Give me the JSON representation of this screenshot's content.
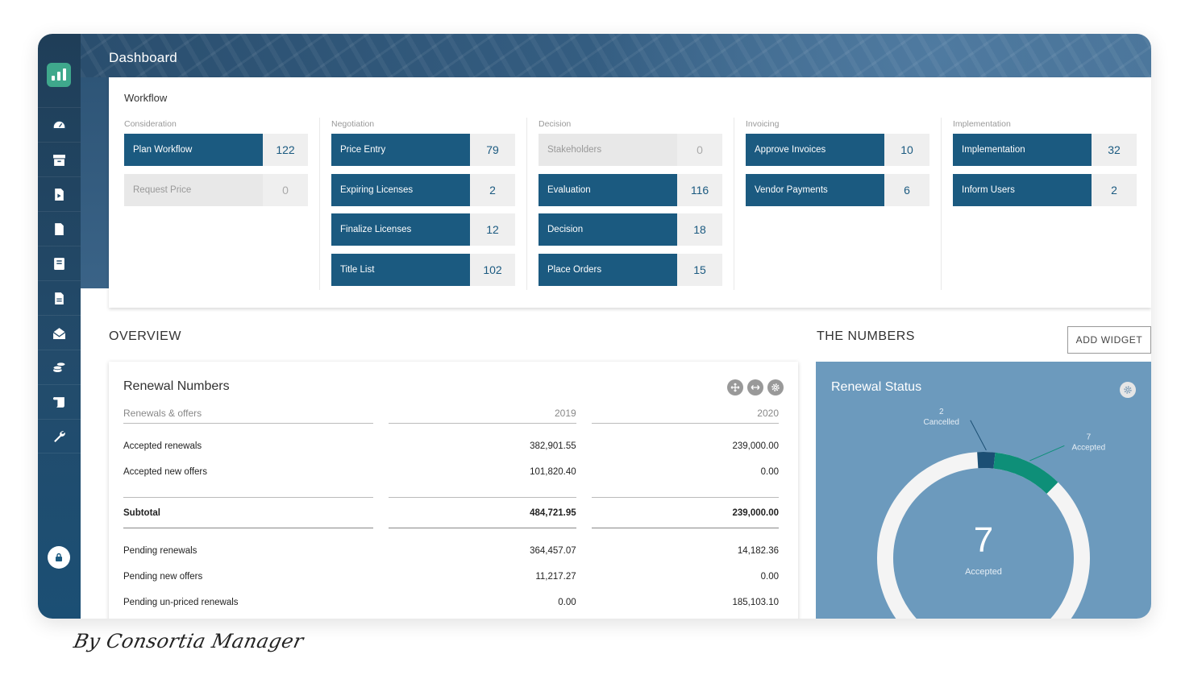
{
  "page": {
    "title": "Dashboard"
  },
  "workflow": {
    "title": "Workflow",
    "columns": [
      {
        "label": "Consideration",
        "items": [
          {
            "label": "Plan Workflow",
            "count": "122",
            "active": true
          },
          {
            "label": "Request Price",
            "count": "0",
            "active": false
          }
        ]
      },
      {
        "label": "Negotiation",
        "items": [
          {
            "label": "Price Entry",
            "count": "79",
            "active": true
          },
          {
            "label": "Expiring Licenses",
            "count": "2",
            "active": true
          },
          {
            "label": "Finalize Licenses",
            "count": "12",
            "active": true
          },
          {
            "label": "Title List",
            "count": "102",
            "active": true
          }
        ]
      },
      {
        "label": "Decision",
        "items": [
          {
            "label": "Stakeholders",
            "count": "0",
            "active": false
          },
          {
            "label": "Evaluation",
            "count": "116",
            "active": true
          },
          {
            "label": "Decision",
            "count": "18",
            "active": true
          },
          {
            "label": "Place Orders",
            "count": "15",
            "active": true
          }
        ]
      },
      {
        "label": "Invoicing",
        "items": [
          {
            "label": "Approve Invoices",
            "count": "10",
            "active": true
          },
          {
            "label": "Vendor Payments",
            "count": "6",
            "active": true
          }
        ]
      },
      {
        "label": "Implementation",
        "items": [
          {
            "label": "Implementation",
            "count": "32",
            "active": true
          },
          {
            "label": "Inform Users",
            "count": "2",
            "active": true
          }
        ]
      }
    ]
  },
  "overview": {
    "heading": "OVERVIEW",
    "card_title": "Renewal Numbers",
    "columns": [
      "Renewals & offers",
      "2019",
      "2020"
    ],
    "rows_top": [
      {
        "label": "Accepted renewals",
        "y2019": "382,901.55",
        "y2020": "239,000.00"
      },
      {
        "label": "Accepted new offers",
        "y2019": "101,820.40",
        "y2020": "0.00"
      }
    ],
    "subtotal": {
      "label": "Subtotal",
      "y2019": "484,721.95",
      "y2020": "239,000.00"
    },
    "rows_bottom": [
      {
        "label": "Pending renewals",
        "y2019": "364,457.07",
        "y2020": "14,182.36"
      },
      {
        "label": "Pending new offers",
        "y2019": "11,217.27",
        "y2020": "0.00"
      },
      {
        "label": "Pending un-priced renewals",
        "y2019": "0.00",
        "y2020": "185,103.10"
      }
    ]
  },
  "numbers": {
    "heading": "THE NUMBERS",
    "add_widget_label": "ADD WIDGET",
    "card_title": "Renewal Status",
    "center_value": "7",
    "center_label": "Accepted",
    "segments": [
      {
        "label": "Cancelled",
        "value": 2,
        "color": "#1b4f74"
      },
      {
        "label": "Accepted",
        "value": 7,
        "color": "#0e8f78"
      }
    ],
    "ring_color": "#f4f4f4"
  },
  "sidebar": {
    "items": [
      "dashboard-icon",
      "archive-icon",
      "video-file-icon",
      "file-icon",
      "book-icon",
      "document-icon",
      "mail-open-icon",
      "coins-icon",
      "scroll-icon",
      "wrench-icon"
    ]
  },
  "brand": {
    "text": "By Consortia Manager"
  },
  "colors": {
    "primary": "#1b5a80",
    "accent": "#3fa88c",
    "card_blue": "#6c9abd"
  }
}
